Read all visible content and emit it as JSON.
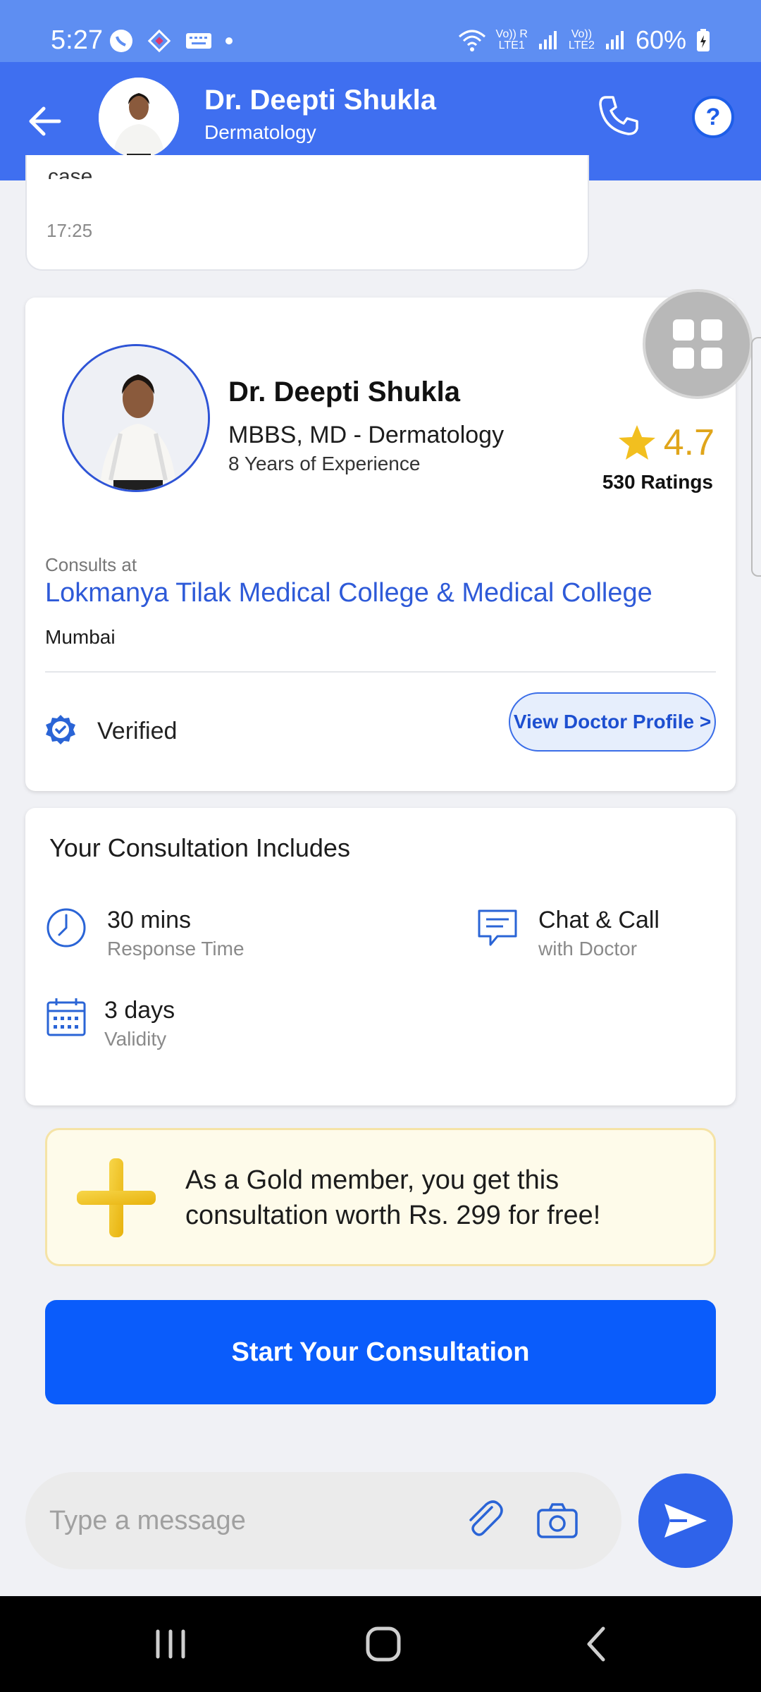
{
  "status_bar": {
    "time": "5:27",
    "battery": "60%",
    "sim1": "LTE1",
    "sim2": "LTE2",
    "volte1": "Vo)) R",
    "volte2": "Vo))"
  },
  "header": {
    "doctor_name": "Dr. Deepti Shukla",
    "specialty": "Dermatology",
    "help_label": "?"
  },
  "previous_message": {
    "partial_text": "case.",
    "time": "17:25"
  },
  "doctor_card": {
    "name": "Dr. Deepti Shukla",
    "degree": "MBBS, MD - Dermatology",
    "experience": "8 Years of Experience",
    "rating": "4.7",
    "ratings_count": "530 Ratings",
    "consults_at_label": "Consults at",
    "hospital": "Lokmanya Tilak Medical College & Medical College",
    "city": "Mumbai",
    "verified_label": "Verified",
    "profile_button": "View Doctor Profile >"
  },
  "consultation": {
    "title": "Your Consultation Includes",
    "items": [
      {
        "main": "30 mins",
        "sub": "Response Time",
        "icon": "clock-icon"
      },
      {
        "main": "Chat & Call",
        "sub": "with Doctor",
        "icon": "chat-icon"
      },
      {
        "main": "3 days",
        "sub": "Validity",
        "icon": "calendar-icon"
      }
    ]
  },
  "gold_banner": {
    "text": "As a Gold member, you get this consultation worth Rs. 299 for free!"
  },
  "cta": {
    "label": "Start Your Consultation"
  },
  "message_input": {
    "placeholder": "Type a message",
    "value": ""
  },
  "colors": {
    "header": "#3f6ff0",
    "accent_blue": "#0a5cfb",
    "rating_star": "#f2bf1f",
    "gold": "#f4c21e"
  }
}
